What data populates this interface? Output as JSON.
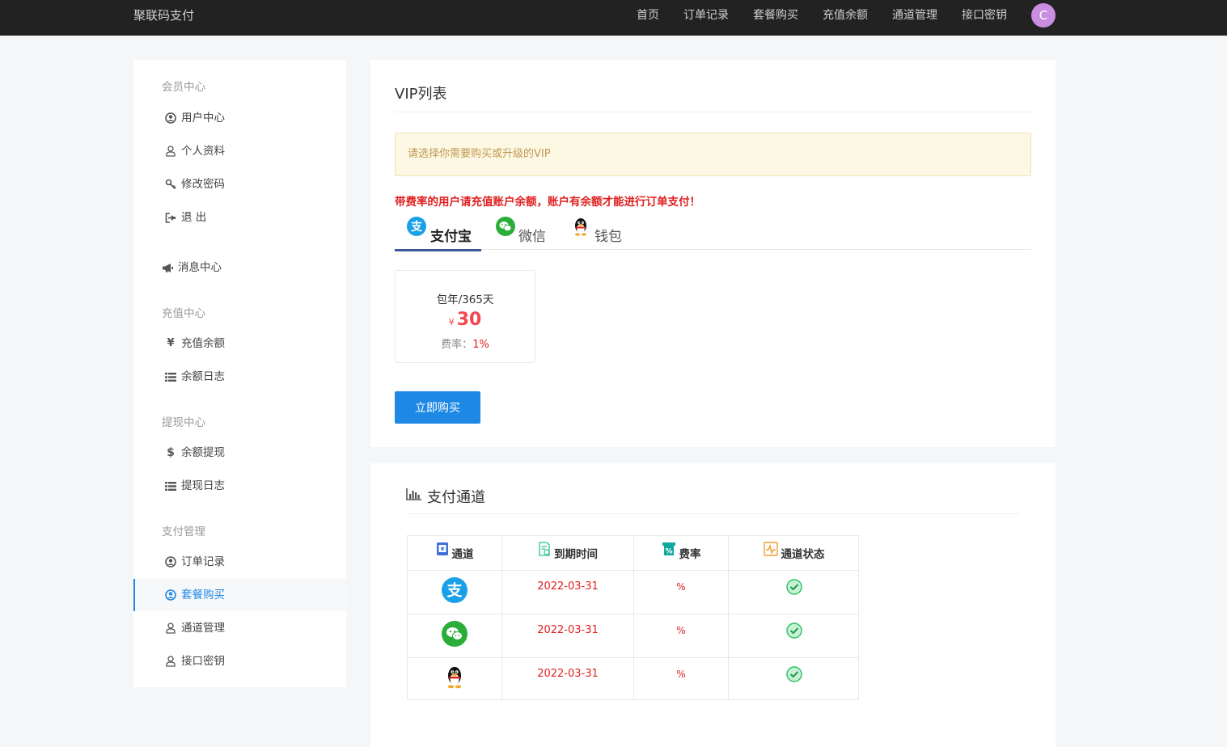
{
  "topbar": {
    "brand": "聚联码支付",
    "nav": [
      "首页",
      "订单记录",
      "套餐购买",
      "充值余额",
      "通道管理",
      "接口密钥"
    ],
    "avatar_letter": "C"
  },
  "sidebar": {
    "member_title": "会员中心",
    "user_center": "用户中心",
    "profile": "个人资料",
    "change_password": "修改密码",
    "logout": "退 出",
    "messages": "消息中心",
    "recharge_title": "充值中心",
    "recharge_balance": "充值余额",
    "balance_log": "余额日志",
    "withdraw_title": "提现中心",
    "withdraw": "余额提现",
    "withdraw_log": "提现日志",
    "pay_title": "支付管理",
    "orders": "订单记录",
    "package_buy": "套餐购买",
    "channel_manage": "通道管理",
    "api_key": "接口密钥"
  },
  "vip": {
    "title": "VIP列表",
    "notice": "请选择你需要购买或升级的VIP",
    "warning": "带费率的用户请充值账户余额，账户有余额才能进行订单支付！",
    "tabs": [
      "支付宝",
      "微信",
      "钱包"
    ],
    "package": {
      "name": "包年/365天",
      "currency": "¥",
      "price": "30",
      "rate_label": "费率：",
      "rate_value": "1%"
    },
    "buy_button": "立即购买"
  },
  "channels": {
    "title": "支付通道",
    "headers": [
      "通道",
      "到期时间",
      "费率",
      "通道状态"
    ],
    "rows": [
      {
        "channel": "alipay",
        "expire": "2022-03-31",
        "rate": "%",
        "status": "ok"
      },
      {
        "channel": "wechat",
        "expire": "2022-03-31",
        "rate": "%",
        "status": "ok"
      },
      {
        "channel": "qq",
        "expire": "2022-03-31",
        "rate": "%",
        "status": "ok"
      }
    ]
  },
  "colors": {
    "topbar": "#222222",
    "primary": "#1e88e5",
    "danger": "#e02020",
    "price": "#f0484e",
    "notice_bg": "#fdf8e4",
    "notice_text": "#c09853",
    "alipay": "#1aa0e8",
    "wechat": "#2aae39",
    "status_ok": "#2bbf62"
  }
}
